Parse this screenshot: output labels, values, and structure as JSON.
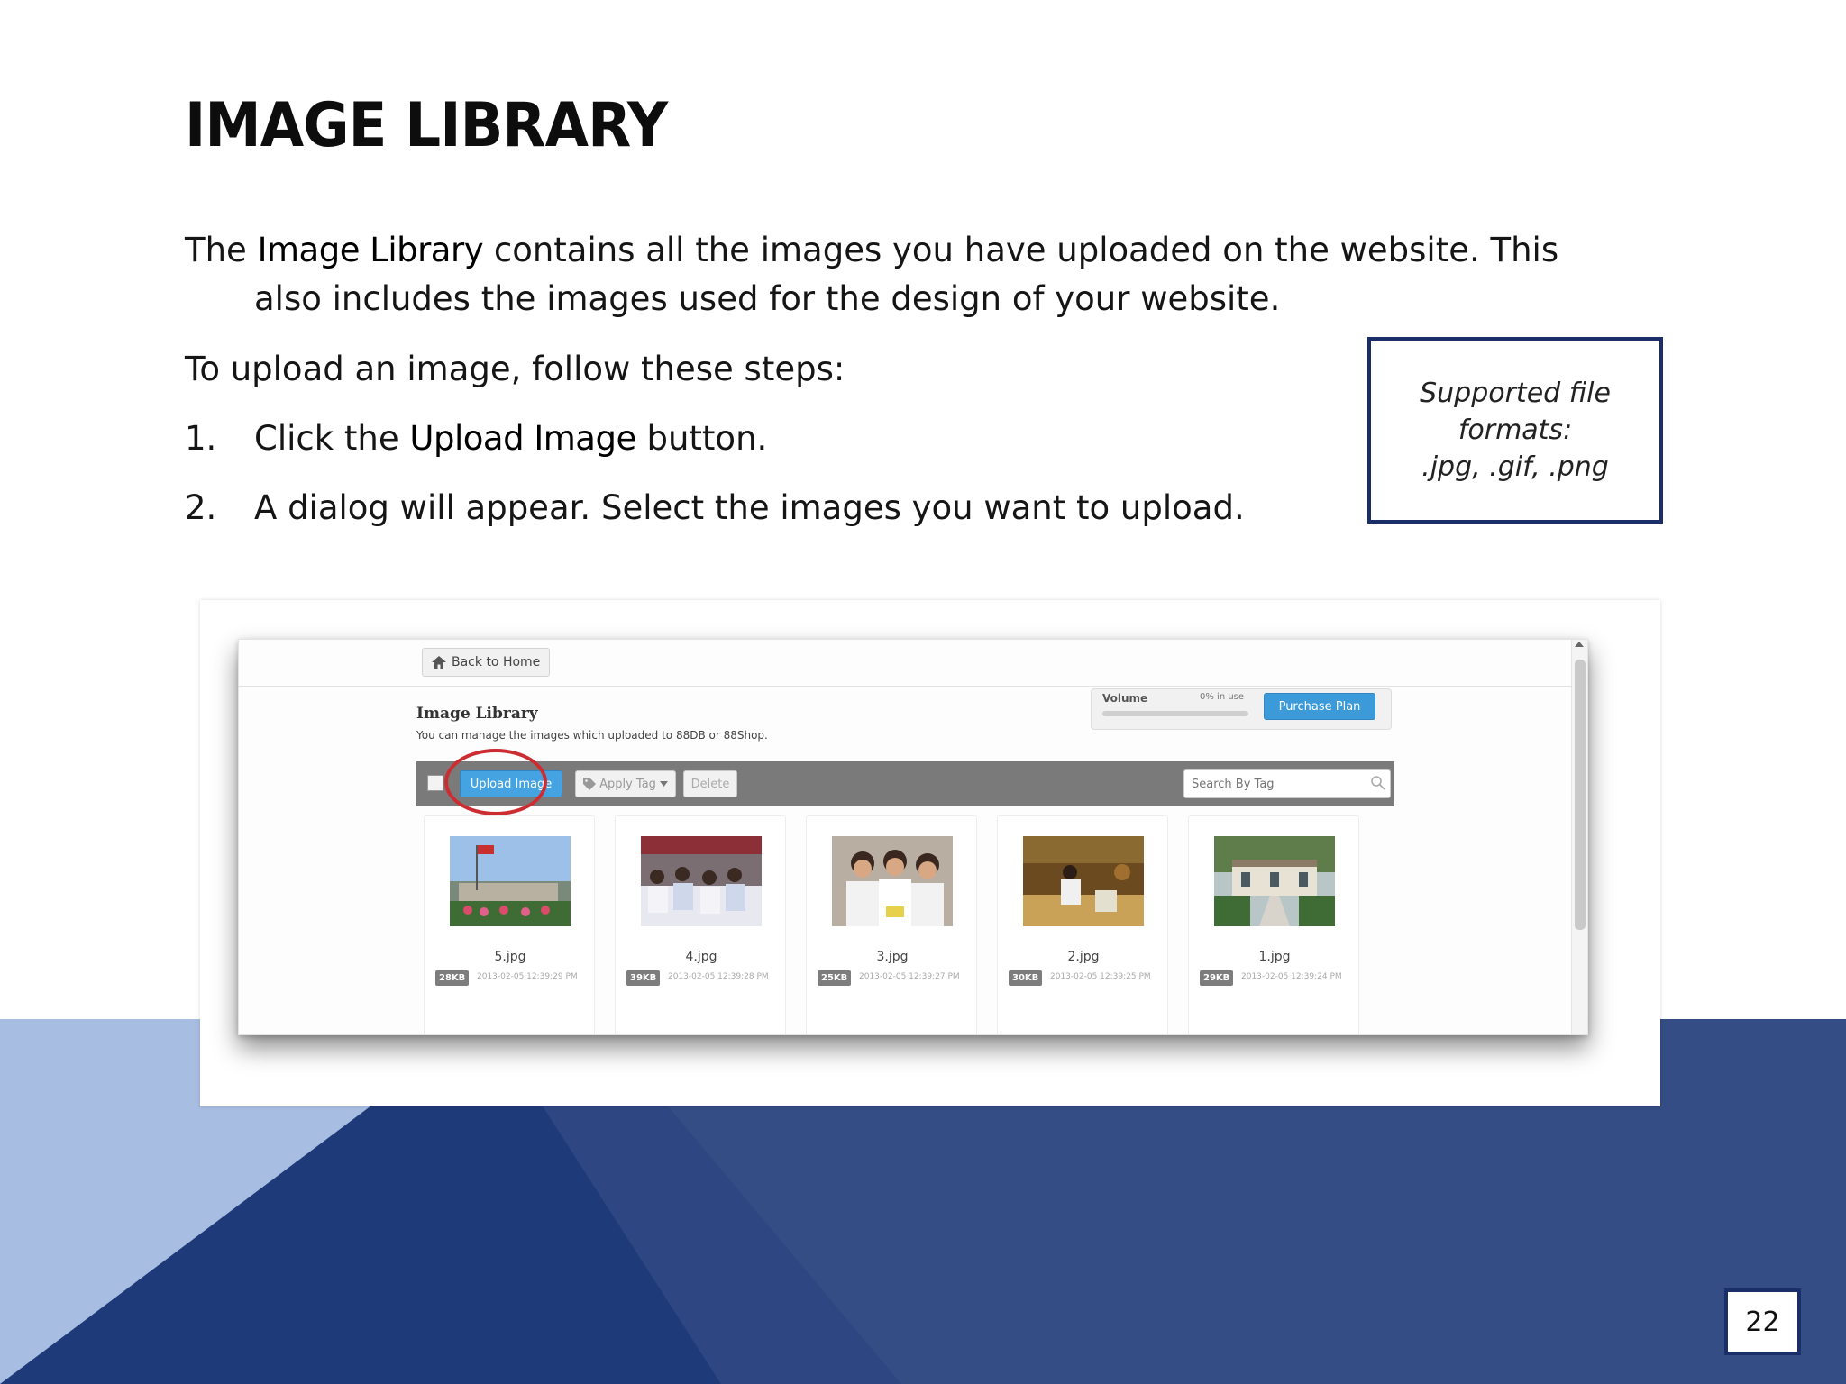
{
  "slide": {
    "title": "IMAGE LIBRARY",
    "para1": {
      "pre": "The ",
      "keyword": "Image Library",
      "post": " contains all the images you have uploaded on the website. This",
      "line2": "also includes the images used for the design of your website."
    },
    "para2": "To upload an image, follow these steps:",
    "steps": [
      {
        "num": "1.",
        "pre": "Click the ",
        "keyword": "Upload Image",
        "post": " button."
      },
      {
        "num": "2.",
        "text": "A dialog will appear. Select the images you want to upload."
      }
    ],
    "callout": {
      "line1": "Supported file",
      "line2": "formats:",
      "line3": ".jpg, .gif, .png"
    },
    "page_number": "22"
  },
  "colors": {
    "navy": "#1a2e6a",
    "light_blue": "#a8bde2",
    "mid_blue": "#344d85",
    "dark_blue": "#1f3a78",
    "accent_button": "#45a3e2",
    "annotation_red": "#cc2d33"
  },
  "app": {
    "back_button": "Back to Home",
    "library_title": "Image Library",
    "library_subtitle": "You can manage the images which uploaded to 88DB or 88Shop.",
    "volume": {
      "label": "Volume",
      "usage": "0% in use",
      "fraction": 0.0
    },
    "purchase_button": "Purchase Plan",
    "toolbar": {
      "upload_button": "Upload Image",
      "apply_tag_button": "Apply Tag",
      "delete_button": "Delete",
      "search_placeholder": "Search By Tag"
    },
    "images": [
      {
        "name": "5.jpg",
        "size": "28KB",
        "date": "2013-02-05 12:39:29 PM"
      },
      {
        "name": "4.jpg",
        "size": "39KB",
        "date": "2013-02-05 12:39:28 PM"
      },
      {
        "name": "3.jpg",
        "size": "25KB",
        "date": "2013-02-05 12:39:27 PM"
      },
      {
        "name": "2.jpg",
        "size": "30KB",
        "date": "2013-02-05 12:39:25 PM"
      },
      {
        "name": "1.jpg",
        "size": "29KB",
        "date": "2013-02-05 12:39:24 PM"
      }
    ]
  }
}
